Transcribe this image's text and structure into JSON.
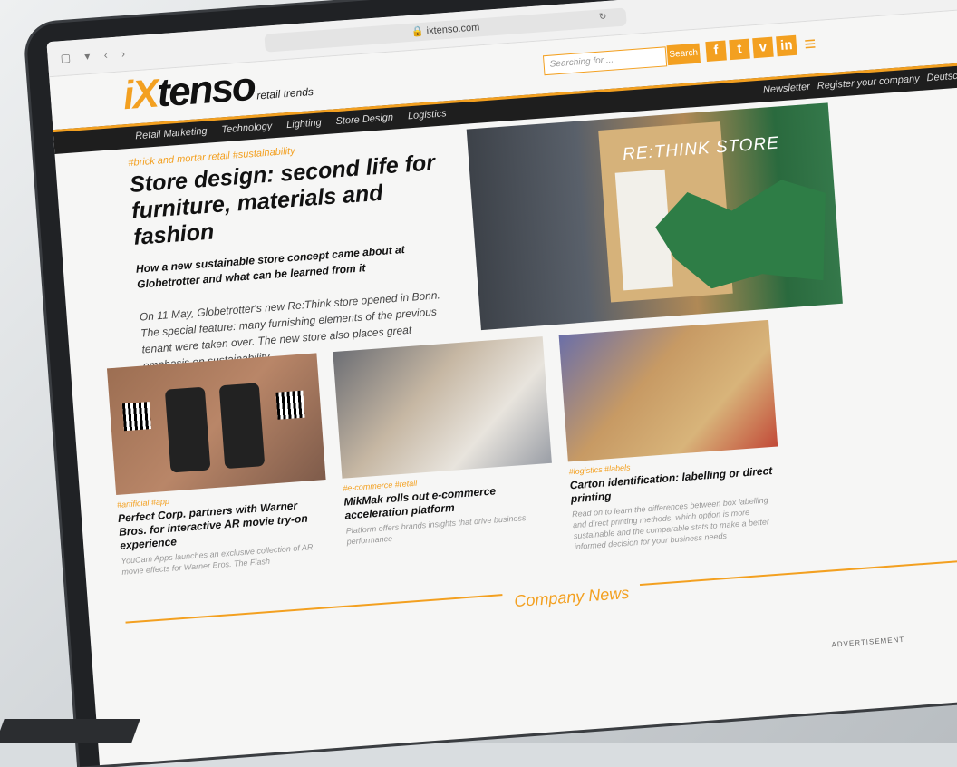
{
  "browser": {
    "url": "ixtenso.com"
  },
  "header": {
    "logo_prefix": "iX",
    "logo_main": "tenso",
    "logo_tagline": "retail trends",
    "search_placeholder": "Searching for ...",
    "search_button": "Search",
    "social": [
      "f",
      "t",
      "v",
      "in"
    ]
  },
  "menu": {
    "left": [
      "Retail Marketing",
      "Technology",
      "Lighting",
      "Store Design",
      "Logistics"
    ],
    "right": [
      "Newsletter",
      "Register your company",
      "Deutsch"
    ]
  },
  "featured": {
    "tags": "#brick and mortar retail   #sustainability",
    "headline": "Store design: second life for furniture, materials and fashion",
    "subhead": "How a new sustainable store concept came about at Globetrotter and what can be learned from it",
    "teaser": "On 11 May, Globetrotter's new Re:Think store opened in Bonn. The special feature: many furnishing elements of the previous tenant were taken over. The new store also places great emphasis on sustainability ...",
    "image_sign": "RE:THINK STORE"
  },
  "cards": [
    {
      "tags": "#artificial   #app",
      "title": "Perfect Corp. partners with Warner Bros. for interactive AR movie try-on experience",
      "desc": "YouCam Apps launches an exclusive collection of AR movie effects for Warner Bros. The Flash"
    },
    {
      "tags": "#e-commerce   #retail",
      "title": "MikMak rolls out e-commerce acceleration platform",
      "desc": "Platform offers brands insights that drive business performance"
    },
    {
      "tags": "#logistics   #labels",
      "title": "Carton identification: labelling or direct printing",
      "desc": "Read on to learn the differences between box labelling and direct printing methods, which option is more sustainable and the comparable stats to make a better informed decision for your business needs"
    }
  ],
  "company_news": "Company News",
  "advertisement": "ADVERTISEMENT"
}
